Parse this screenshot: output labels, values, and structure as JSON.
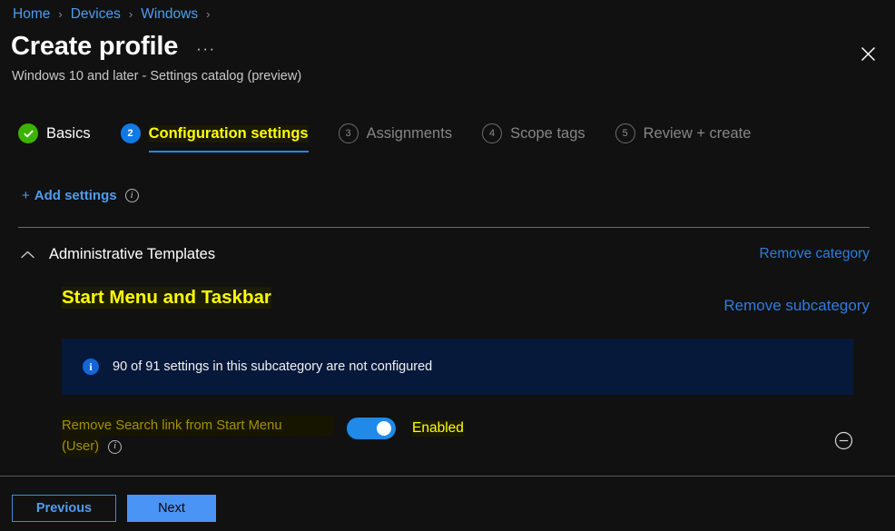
{
  "breadcrumb": {
    "items": [
      "Home",
      "Devices",
      "Windows"
    ],
    "separator": "›",
    "trailing_separator": "›"
  },
  "header": {
    "title": "Create profile",
    "more_label": "···",
    "subtitle": "Windows 10 and later - Settings catalog (preview)",
    "close_icon": "close-icon"
  },
  "steps": [
    {
      "badge": "✓",
      "label": "Basics",
      "state": "done"
    },
    {
      "badge": "2",
      "label": "Configuration settings",
      "state": "active"
    },
    {
      "badge": "3",
      "label": "Assignments",
      "state": "idle"
    },
    {
      "badge": "4",
      "label": "Scope tags",
      "state": "idle"
    },
    {
      "badge": "5",
      "label": "Review + create",
      "state": "idle"
    }
  ],
  "toolbar": {
    "add_plus": "+",
    "add_label": "Add settings",
    "add_info_icon": "info-icon",
    "add_info_glyph": "i"
  },
  "category": {
    "chevron_icon": "chevron-up-icon",
    "name": "Administrative Templates",
    "remove_label": "Remove category"
  },
  "subcategory": {
    "name": "Start Menu and Taskbar",
    "remove_label": "Remove subcategory"
  },
  "banner": {
    "icon": "info-circle-icon",
    "icon_glyph": "i",
    "text": "90 of 91 settings in this subcategory are not configured",
    "background": "#06193b"
  },
  "setting": {
    "label_line1": "Remove Search link from Start Menu",
    "label_line2": "(User)",
    "info_icon": "info-icon",
    "info_glyph": "i",
    "toggle_on": true,
    "state_label": "Enabled",
    "remove_icon": "remove-circle-icon"
  },
  "footer": {
    "previous_label": "Previous",
    "next_label": "Next"
  },
  "colors": {
    "page_background": "#111111",
    "accent_blue": "#1f8ae8",
    "link_blue": "#4f9cf0",
    "highlight_yellow": "#ffff00",
    "dim_yellow": "#a39000",
    "success_green": "#3db300",
    "banner_blue": "#06193b"
  }
}
